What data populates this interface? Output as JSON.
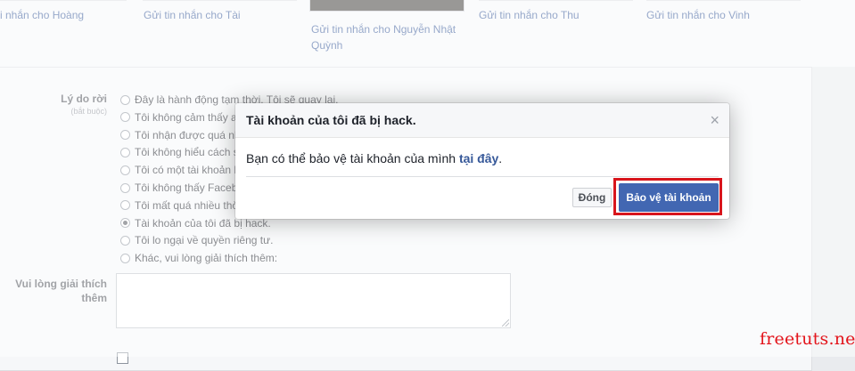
{
  "friends": [
    {
      "label": "i nhắn cho Hoàng"
    },
    {
      "label": "Gửi tin nhắn cho Tài"
    },
    {
      "label": "Gửi tin nhắn cho Nguyễn Nhật Quỳnh"
    },
    {
      "label": "Gửi tin nhắn cho Thu"
    },
    {
      "label": "Gửi tin nhắn cho Vinh"
    }
  ],
  "form": {
    "reason_label": "Lý do rời",
    "reason_required": "(bắt buộc)",
    "reasons": [
      {
        "label": "Đây là hành động tạm thời. Tôi sẽ quay lại.",
        "checked": false
      },
      {
        "label": "Tôi không cảm thấy an toàn trên Facebook.",
        "checked": false
      },
      {
        "label": "Tôi nhận được quá nhiều email, lời mời.",
        "checked": false
      },
      {
        "label": "Tôi không hiểu cách sử dụng Facebook.",
        "checked": false
      },
      {
        "label": "Tôi có một tài khoản Facebook khác.",
        "checked": false
      },
      {
        "label": "Tôi không thấy Facebook hữu ích.",
        "checked": false
      },
      {
        "label": "Tôi mất quá nhiều thời gian dùng Facebook.",
        "checked": false
      },
      {
        "label": "Tài khoản của tôi đã bị hack.",
        "checked": true
      },
      {
        "label": "Tôi lo ngại về quyền riêng tư.",
        "checked": false
      },
      {
        "label": "Khác, vui lòng giải thích thêm:",
        "checked": false
      }
    ],
    "explain_label": "Vui lòng giải thích thêm",
    "explain_value": ""
  },
  "dialog": {
    "title": "Tài khoản của tôi đã bị hack.",
    "close_glyph": "×",
    "body_text": "Bạn có thể bảo vệ tài khoản của mình ",
    "body_link": "tại đây",
    "body_end": ".",
    "close_button": "Đóng",
    "primary_button": "Bảo vệ tài khoản"
  },
  "colors": {
    "link": "#365899",
    "primary_button": "#4267b2",
    "highlight_frame": "#d8151c"
  },
  "watermark": "freetuts.net"
}
